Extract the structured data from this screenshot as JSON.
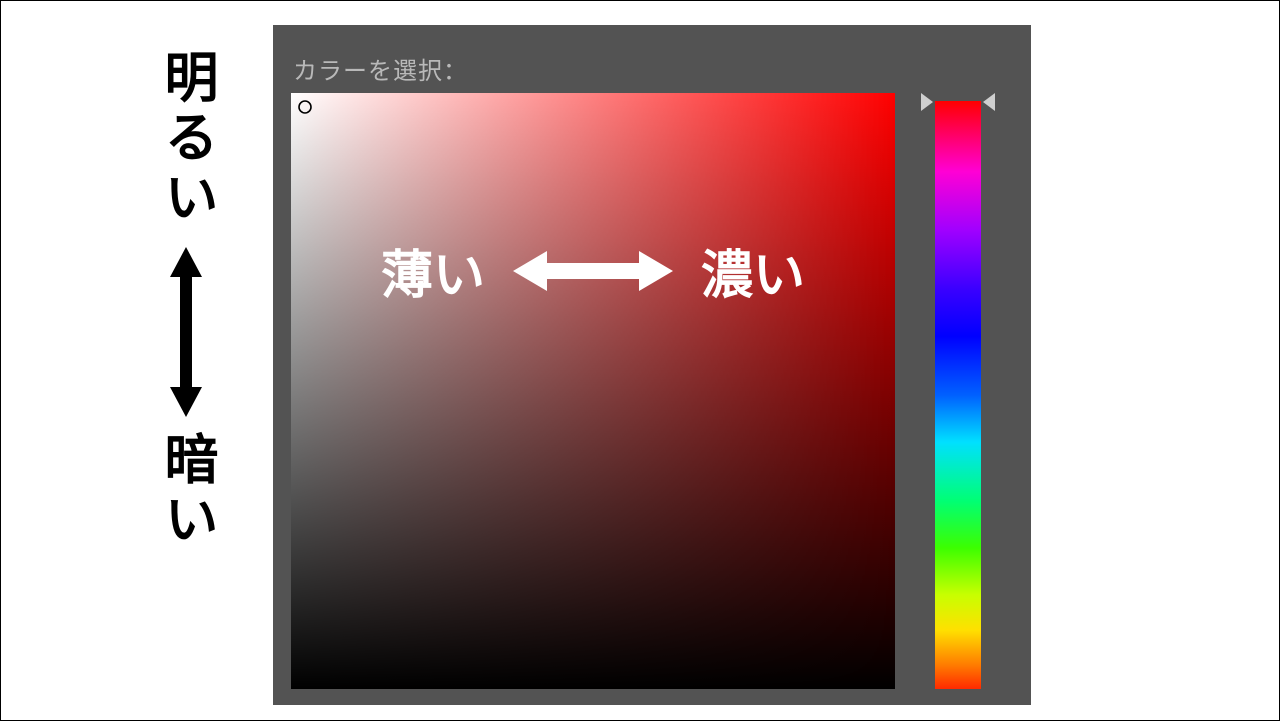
{
  "diagram": {
    "vertical_axis": {
      "top_label": "明るい",
      "bottom_label": "暗い"
    },
    "overlay": {
      "left_label": "薄い",
      "right_label": "濃い"
    }
  },
  "picker": {
    "title": "カラーを選択：",
    "current_hue_hex": "#ff0000",
    "hue_position_percent": 0
  },
  "colors": {
    "panel_bg": "#535353",
    "panel_label": "#b9b9b9"
  }
}
